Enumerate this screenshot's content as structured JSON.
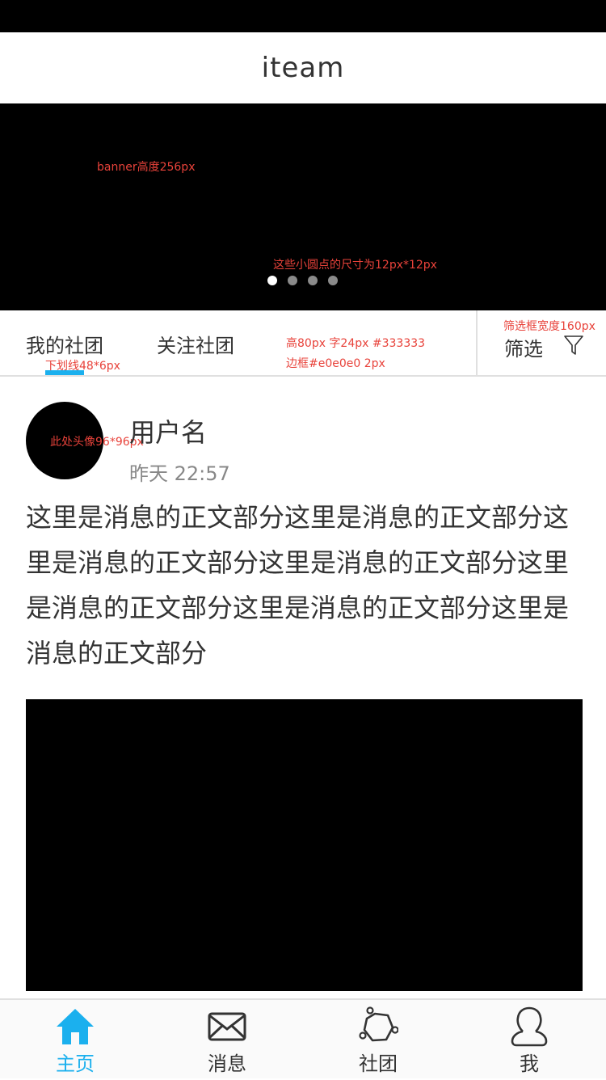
{
  "header": {
    "title": "iteam"
  },
  "banner": {
    "notes": {
      "height": "banner高度256px",
      "dots": "这些小圆点的尺寸为12px*12px"
    },
    "dot_count": 4,
    "active_dot": 1
  },
  "tabs": {
    "items": [
      {
        "label": "我的社团"
      },
      {
        "label": "关注社团"
      }
    ],
    "active": 0,
    "filter_label": "筛选",
    "notes": {
      "underline": "下划线48*6px",
      "spec_line1": "高80px 字24px  #333333",
      "spec_line2": "边框#e0e0e0 2px",
      "filter_width": "筛选框宽度160px"
    }
  },
  "post": {
    "username": "用户名",
    "time": "昨天 22:57",
    "avatar_note": "此处头像96*96px",
    "body": "这里是消息的正文部分这里是消息的正文部分这里是消息的正文部分这里是消息的正文部分这里是消息的正文部分这里是消息的正文部分这里是消息的正文部分"
  },
  "tabbar": {
    "items": [
      {
        "label": "主页",
        "icon": "home-icon"
      },
      {
        "label": "消息",
        "icon": "mail-icon"
      },
      {
        "label": "社团",
        "icon": "group-icon"
      },
      {
        "label": "我",
        "icon": "user-icon"
      }
    ],
    "active": 0
  },
  "colors": {
    "accent": "#1bb0ee",
    "text": "#333333",
    "border": "#e0e0e0",
    "annotation": "#e8423a"
  }
}
